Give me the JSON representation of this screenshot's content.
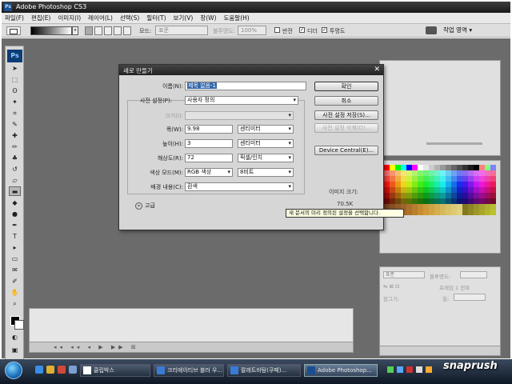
{
  "window": {
    "title": "Adobe Photoshop CS3",
    "logo": "Ps"
  },
  "menu": [
    "파일(F)",
    "편집(E)",
    "이미지(I)",
    "레이어(L)",
    "선택(S)",
    "필터(T)",
    "보기(V)",
    "창(W)",
    "도움말(H)"
  ],
  "options": {
    "mode_label": "모드:",
    "mode_value": "표준",
    "opacity_label": "불투명도:",
    "opacity_value": "100%",
    "reverse_label": "반전",
    "dither_label": "디더",
    "transparency_label": "투명도",
    "workspace_label": "작업 영역 ▾"
  },
  "dialog": {
    "title": "새로 만들기",
    "name_label": "이름(N):",
    "name_value": "제목 없음-1",
    "preset_label": "사전 설정(P):",
    "preset_value": "사용자 정의",
    "size_label": "크기(I):",
    "width_label": "폭(W):",
    "width_value": "9.98",
    "width_unit": "센티미터",
    "height_label": "높이(H):",
    "height_value": "3",
    "height_unit": "센티미터",
    "resolution_label": "해상도(R):",
    "resolution_value": "72",
    "resolution_unit": "픽셀/인치",
    "colormode_label": "색상 모드(M):",
    "colormode_value": "RGB 색상",
    "bits_value": "8비트",
    "bg_label": "배경 내용(C):",
    "bg_value": "흰색",
    "advanced_label": "고급",
    "ok_label": "확인",
    "cancel_label": "취소",
    "save_preset_label": "사전 설정 저장(S)...",
    "delete_preset_label": "사전 설정 삭제(D)...",
    "device_central_label": "Device Central(E)...",
    "image_size_label": "이미지 크기:",
    "image_size_value": "70.5K"
  },
  "tooltip": "새 문서의 미리 정의된 설정을 선택합니다.",
  "layers_panel": {
    "blend_value": "표준",
    "opacity_label": "불투명도:",
    "lock_label": "잠그기:",
    "unify_label": "프레임 1 전파",
    "fill_label": "칠:"
  },
  "taskbar": {
    "tasks": [
      "클립박스",
      "크리에이티브 블러 우...",
      "팔레트바탐(쿠페)...",
      "Adobe Photoshop..."
    ],
    "watermark": "snaprush"
  },
  "colors": {
    "accent": "#3366aa",
    "workspace": "#6b6b6b"
  }
}
